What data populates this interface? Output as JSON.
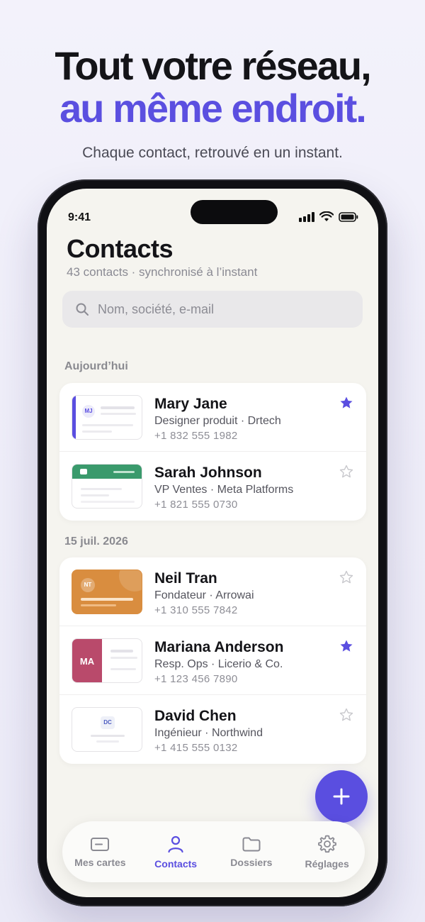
{
  "hero": {
    "line1": "Tout votre réseau,",
    "line2": "au même endroit.",
    "subtitle": "Chaque contact, retrouvé en un instant."
  },
  "status_bar": {
    "time": "9:41"
  },
  "header": {
    "title": "Contacts",
    "subtitle": "43 contacts · synchronisé à l’instant"
  },
  "search": {
    "placeholder": "Nom, société, e-mail"
  },
  "sections": [
    {
      "label": "Aujourd’hui",
      "contacts": [
        {
          "name": "Mary Jane",
          "role": "Designer produit · Drtech",
          "phone": "+1 832 555 1982",
          "starred": true,
          "initials": "MJ"
        },
        {
          "name": "Sarah Johnson",
          "role": "VP Ventes · Meta Platforms",
          "phone": "+1 821 555 0730",
          "starred": false,
          "initials": ""
        }
      ]
    },
    {
      "label": "15 juil. 2026",
      "contacts": [
        {
          "name": "Neil Tran",
          "role": "Fondateur · Arrowai",
          "phone": "+1 310 555 7842",
          "starred": false,
          "initials": "NT"
        },
        {
          "name": "Mariana Anderson",
          "role": "Resp. Ops · Licerio & Co.",
          "phone": "+1 123 456 7890",
          "starred": true,
          "initials": "MA"
        },
        {
          "name": "David Chen",
          "role": "Ingénieur · Northwind",
          "phone": "+1 415 555 0132",
          "starred": false,
          "initials": "DC"
        }
      ]
    }
  ],
  "tabs": [
    {
      "label": "Mes cartes",
      "icon": "card-icon",
      "active": false
    },
    {
      "label": "Contacts",
      "icon": "person-icon",
      "active": true
    },
    {
      "label": "Dossiers",
      "icon": "folder-icon",
      "active": false
    },
    {
      "label": "Réglages",
      "icon": "gear-icon",
      "active": false
    }
  ],
  "colors": {
    "accent": "#5b4fe0",
    "star_on": "#5a4ee0",
    "star_off": "#c8c8cc"
  }
}
